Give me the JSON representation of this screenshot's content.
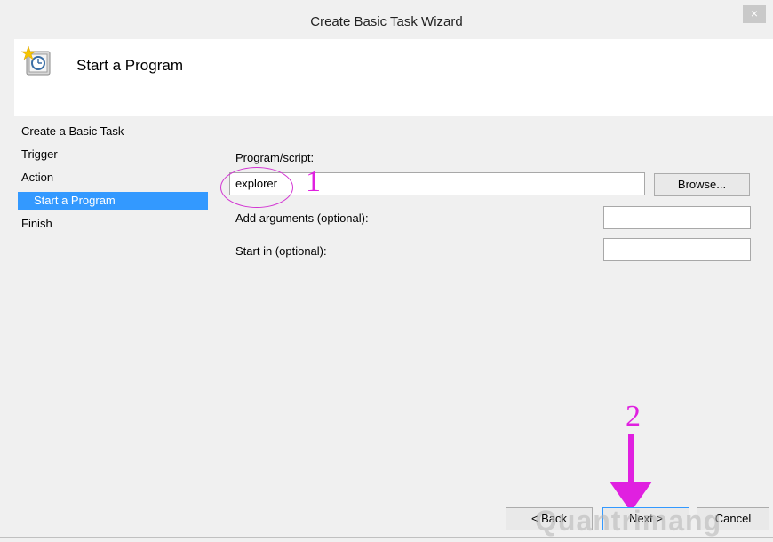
{
  "window": {
    "title": "Create Basic Task Wizard",
    "close_glyph": "×"
  },
  "header": {
    "title": "Start a Program",
    "icon": "task-clock-icon"
  },
  "nav": {
    "items": [
      {
        "label": "Create a Basic Task"
      },
      {
        "label": "Trigger"
      },
      {
        "label": "Action"
      },
      {
        "label": "Start a Program"
      },
      {
        "label": "Finish"
      }
    ]
  },
  "form": {
    "program_label": "Program/script:",
    "program_value": "explorer",
    "browse_label": "Browse...",
    "args_label": "Add arguments (optional):",
    "args_value": "",
    "startin_label": "Start in (optional):",
    "startin_value": ""
  },
  "footer": {
    "back_label": "< Back",
    "next_label": "Next >",
    "cancel_label": "Cancel"
  },
  "annotations": {
    "one": "1",
    "two": "2",
    "accent_color": "#e020e0"
  },
  "watermark": {
    "text": "Quantrimang"
  },
  "colors": {
    "selection": "#3399ff"
  }
}
